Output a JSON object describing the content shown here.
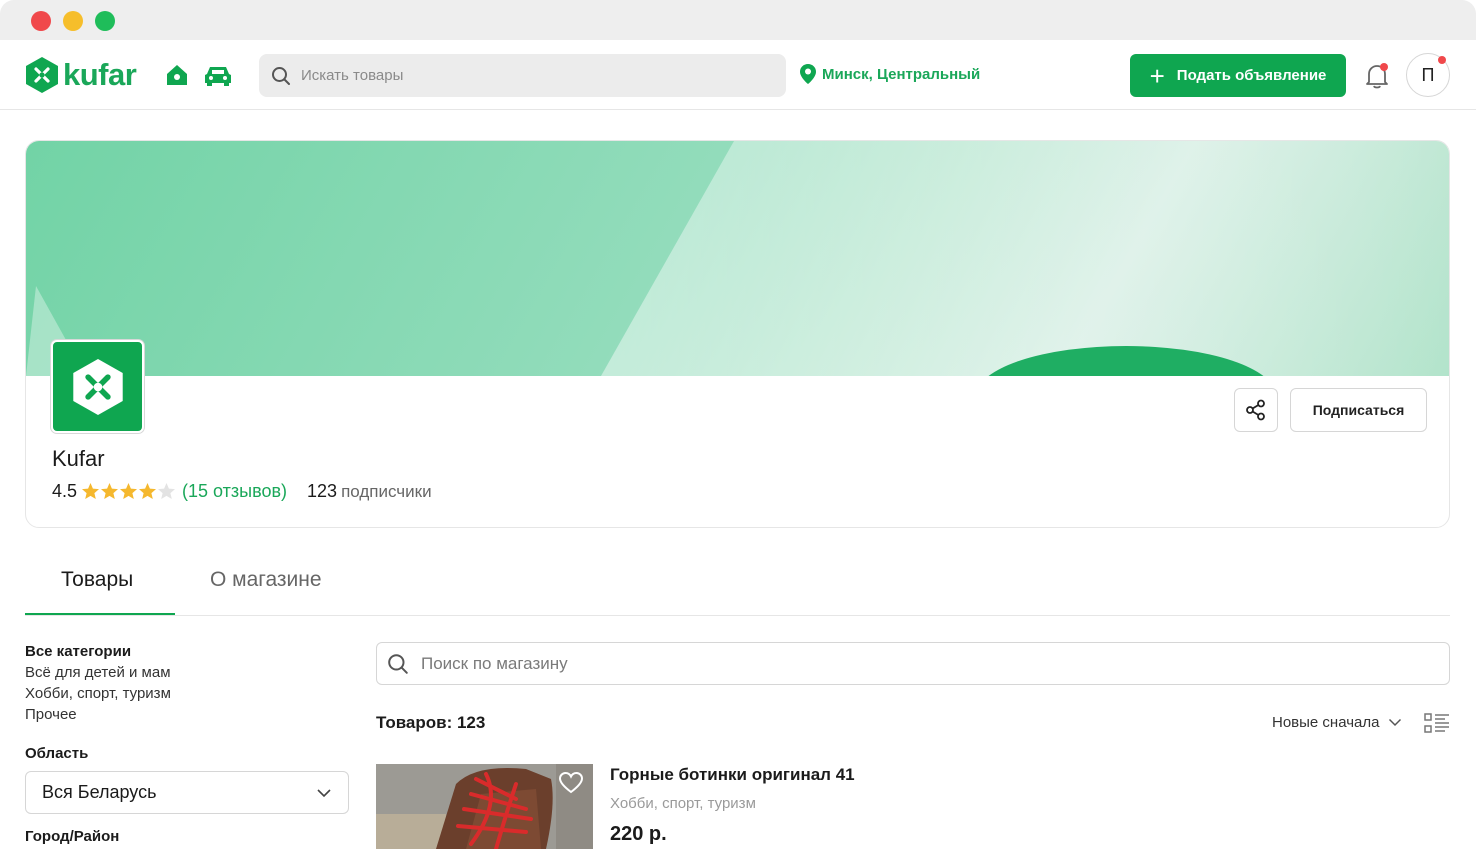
{
  "header": {
    "logo_text": "kufar",
    "search_placeholder": "Искать товары",
    "location": "Минск, Центральный",
    "post_button": "Подать объявление",
    "avatar_letter": "П"
  },
  "shop": {
    "name": "Kufar",
    "rating": "4.5",
    "rating_value": 4.5,
    "reviews": "(15 отзывов)",
    "followers_count": "123",
    "followers_label": "подписчики",
    "subscribe_button": "Подписаться"
  },
  "tabs": [
    {
      "label": "Товары",
      "active": true
    },
    {
      "label": "О магазине",
      "active": false
    }
  ],
  "sidebar": {
    "categories_title": "Все категории",
    "categories": [
      "Всё для детей и мам",
      "Хобби, спорт, туризм",
      "Прочее"
    ],
    "region_title": "Область",
    "region_value": "Вся Беларусь",
    "city_title": "Город/Район"
  },
  "listing": {
    "search_placeholder": "Поиск по магазину",
    "count_label": "Товаров: 123",
    "sort_label": "Новые сначала"
  },
  "products": [
    {
      "title": "Горные ботинки оригинал 41",
      "category": "Хобби, спорт, туризм",
      "price": "220 р."
    }
  ],
  "colors": {
    "brand_green": "#0fa650",
    "link_green": "#1aa759",
    "star_gold": "#f5b82e",
    "notification_red": "#f0484b"
  },
  "icons": [
    "search-icon",
    "home-icon",
    "car-icon",
    "location-pin-icon",
    "plus-icon",
    "bell-icon",
    "share-icon",
    "chevron-down-icon",
    "list-view-icon",
    "heart-icon"
  ]
}
